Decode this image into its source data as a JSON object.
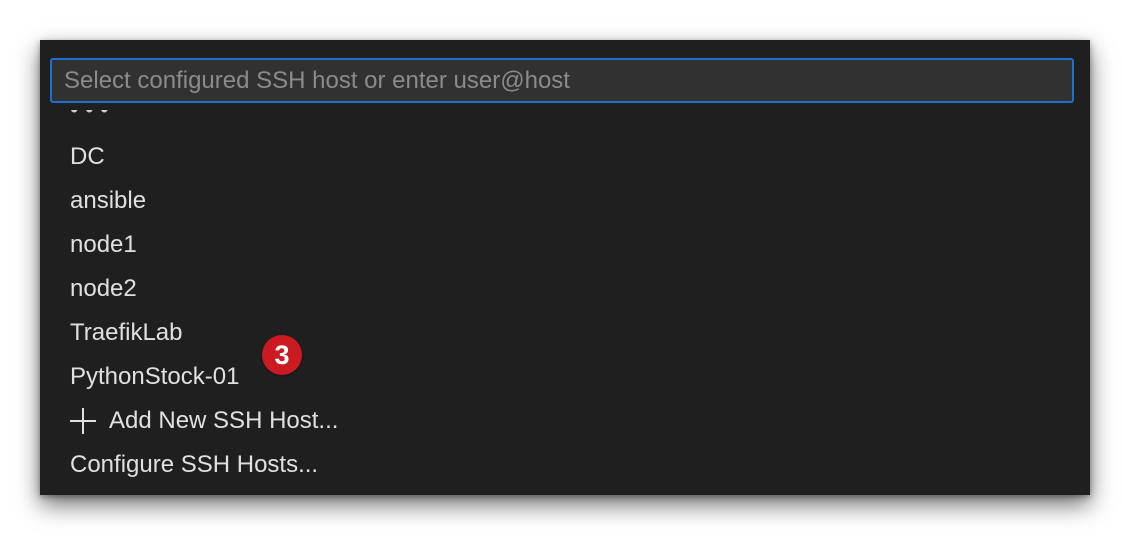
{
  "quick_pick": {
    "placeholder": "Select configured SSH host or enter user@host",
    "hosts": [
      {
        "label": "DC"
      },
      {
        "label": "ansible"
      },
      {
        "label": "node1"
      },
      {
        "label": "node2"
      },
      {
        "label": "TraefikLab"
      },
      {
        "label": "PythonStock-01"
      }
    ],
    "add_host_label": "Add New SSH Host...",
    "configure_label": "Configure SSH Hosts...",
    "clipped_item_text": "• • •"
  },
  "annotation": {
    "step_number": "3",
    "badge_color": "#cc1a22"
  },
  "colors": {
    "panel_background": "#1f1f1f",
    "input_background": "#313131",
    "focus_border": "#1f6fd1",
    "item_text": "#e0e0e0",
    "placeholder_text": "#8b8b8b"
  },
  "icons": {
    "add_host": "plus-icon"
  }
}
